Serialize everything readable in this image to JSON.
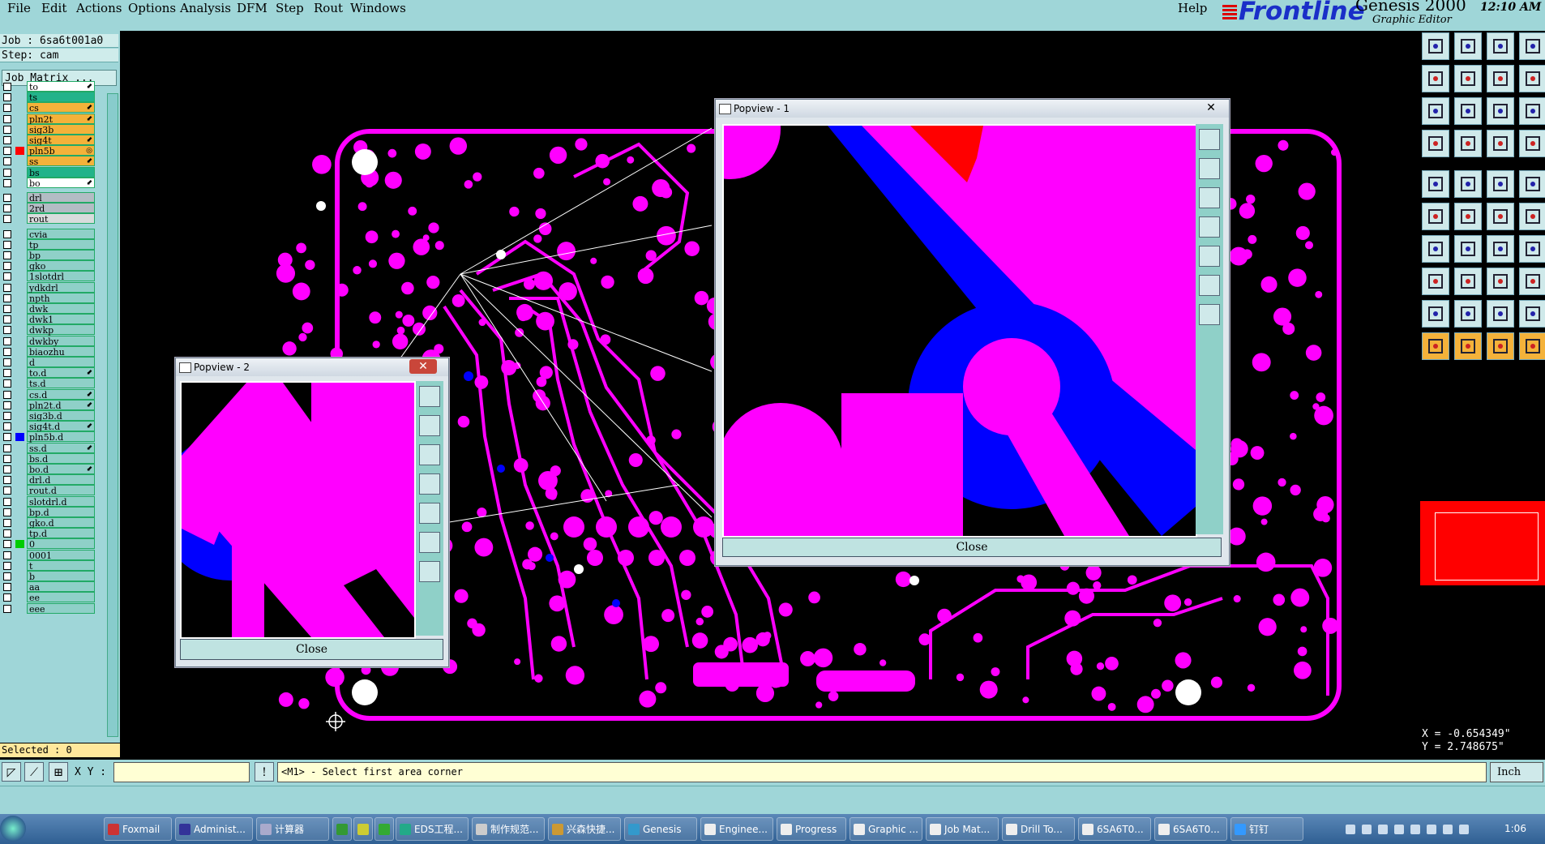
{
  "menu": {
    "items": [
      "File",
      "Edit",
      "Actions",
      "Options",
      "Analysis",
      "DFM",
      "Step",
      "Rout",
      "Windows"
    ],
    "help": "Help"
  },
  "brand": {
    "logo": "Frontline",
    "title": "Genesis 2000",
    "subtitle": "Graphic Editor",
    "time": "12:10 AM"
  },
  "left": {
    "job": "Job : 6sa6t001a0",
    "step": "Step: cam",
    "matrix_button": "Job Matrix ...",
    "selected": "Selected : 0"
  },
  "layers_board": [
    {
      "name": "to",
      "bg": "#ffffff",
      "mark": "⬋"
    },
    {
      "name": "ts",
      "bg": "#22b38a",
      "mark": ""
    },
    {
      "name": "cs",
      "bg": "#f4b23a",
      "mark": "⬋"
    },
    {
      "name": "pln2t",
      "bg": "#f4b23a",
      "mark": "⬋"
    },
    {
      "name": "sig3b",
      "bg": "#f4b23a",
      "mark": ""
    },
    {
      "name": "sig4t",
      "bg": "#f4b23a",
      "mark": "⬋"
    },
    {
      "name": "pln5b",
      "bg": "#f4b23a",
      "mark": "◎",
      "color": "#ff0000"
    },
    {
      "name": "ss",
      "bg": "#f4b23a",
      "mark": "⬋"
    },
    {
      "name": "bs",
      "bg": "#22b38a",
      "mark": ""
    },
    {
      "name": "bo",
      "bg": "#ffffff",
      "mark": "⬋"
    }
  ],
  "layers_drill": [
    {
      "name": "drl",
      "bg": "#b3bcc4"
    },
    {
      "name": "2rd",
      "bg": "#b3bcc4"
    },
    {
      "name": "rout",
      "bg": "#d8dcdc"
    }
  ],
  "layers_misc": [
    {
      "name": "cvia"
    },
    {
      "name": "tp"
    },
    {
      "name": "bp"
    },
    {
      "name": "gko"
    },
    {
      "name": "1slotdrl"
    },
    {
      "name": "ydkdrl"
    },
    {
      "name": "npth"
    },
    {
      "name": "dwk"
    },
    {
      "name": "dwk1"
    },
    {
      "name": "dwkp"
    },
    {
      "name": "dwkby"
    },
    {
      "name": "biaozhu"
    },
    {
      "name": "d"
    },
    {
      "name": "to.d",
      "mark": "⬋"
    },
    {
      "name": "ts.d"
    },
    {
      "name": "cs.d",
      "mark": "⬋"
    },
    {
      "name": "pln2t.d",
      "mark": "⬋"
    },
    {
      "name": "sig3b.d"
    },
    {
      "name": "sig4t.d",
      "mark": "⬋"
    },
    {
      "name": "pln5b.d",
      "color": "#0000ff"
    },
    {
      "name": "ss.d",
      "mark": "⬋"
    },
    {
      "name": "bs.d"
    },
    {
      "name": "bo.d",
      "mark": "⬋"
    },
    {
      "name": "drl.d"
    },
    {
      "name": "rout.d"
    },
    {
      "name": "slotdrl.d"
    },
    {
      "name": "bp.d"
    },
    {
      "name": "gko.d"
    },
    {
      "name": "tp.d"
    },
    {
      "name": "0",
      "color": "#00cc00"
    },
    {
      "name": "0001"
    },
    {
      "name": "t"
    },
    {
      "name": "b"
    },
    {
      "name": "aa"
    },
    {
      "name": "ee"
    },
    {
      "name": "eee"
    }
  ],
  "coords": {
    "x": "X = -0.654349\"",
    "y": "Y = 2.748675\""
  },
  "command": {
    "xy_label": "X Y :",
    "xy_value": "",
    "prompt": "<M1> - Select first area corner",
    "units": "Inch"
  },
  "popview1": {
    "title": "Popview - 1",
    "close": "Close"
  },
  "popview2": {
    "title": "Popview - 2",
    "close": "Close"
  },
  "taskbar": {
    "items": [
      "Foxmail",
      "Administ...",
      "计算器",
      "",
      "",
      "",
      "EDS工程...",
      "制作规范...",
      "兴森快捷...",
      "Genesis",
      "Enginee...",
      "Progress",
      "Graphic ...",
      "Job Mat...",
      "Drill To...",
      "6SA6T0...",
      "6SA6T0...",
      "钉钉"
    ],
    "time": "1:06"
  },
  "colors": {
    "accent": "#9fd6d8",
    "copper": "#ff00ff",
    "plane": "#0000ff",
    "highlight": "#ff0000"
  }
}
